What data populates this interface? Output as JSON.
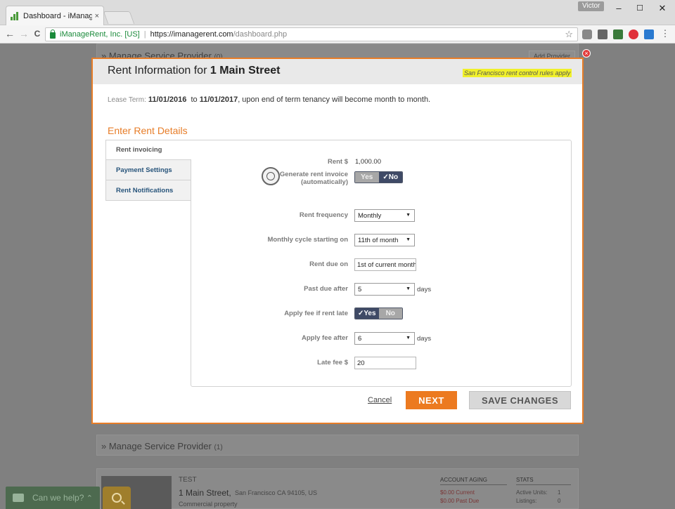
{
  "browser": {
    "tab_title": "Dashboard - iManageRe",
    "tab_close": "×",
    "user_chip": "Victor",
    "min": "–",
    "max": "☐",
    "close": "✕",
    "back": "←",
    "forward": "→",
    "reload": "C",
    "secure_org": "iManageRent, Inc. [US]",
    "url_sep": "|",
    "url_host": "https://imanagerent.com",
    "url_path": "/dashboard.php",
    "star": "☆",
    "menu": "⋮"
  },
  "background": {
    "top_heading": "» Manage Service Provider",
    "top_heading_count": "(0)",
    "add_provider": "Add Provider",
    "mid_heading": "» Manage Service Provider",
    "mid_heading_count": "(1)",
    "listing_tag": "TEST",
    "listing_title": "1 Main Street,",
    "listing_addr": "San Francisco CA 94105, US",
    "listing_type": "Commercial property",
    "aging_header": "ACCOUNT AGING",
    "aging_current": "$0.00 Current",
    "aging_past_due": "$0.00 Past Due",
    "stats_header": "STATS",
    "stats_units_label": "Active Units:",
    "stats_units_value": "1",
    "stats_listings_label": "Listings:",
    "stats_listings_value": "0"
  },
  "chat": {
    "label": "Can we help?",
    "chevron": "⌃"
  },
  "modal": {
    "close": "×",
    "title_prefix": "Rent Information for",
    "title_address": "1 Main Street",
    "rule_badge": "San Francisco rent control rules apply",
    "lease_label": "Lease Term:",
    "lease_start": "11/01/2016",
    "lease_to": "to",
    "lease_end": "11/01/2017",
    "lease_suffix": ", upon end of term tenancy will become month to month.",
    "section_title": "Enter Rent Details",
    "tabs": [
      {
        "label": "Rent invoicing"
      },
      {
        "label": "Payment Settings"
      },
      {
        "label": "Rent Notifications"
      }
    ],
    "form": {
      "rent_label": "Rent $",
      "rent_value": "1,000.00",
      "gen_invoice_label": "Generate rent invoice",
      "gen_invoice_sub": "(automatically)",
      "gen_invoice_yes": "Yes",
      "gen_invoice_no": "✓No",
      "frequency_label": "Rent frequency",
      "frequency_value": "Monthly",
      "cycle_label": "Monthly cycle starting on",
      "cycle_value": "11th of month",
      "due_label": "Rent due on",
      "due_value": "1st of current month",
      "past_due_label": "Past due after",
      "past_due_value": "5",
      "past_due_unit": "days",
      "apply_fee_label": "Apply fee if rent late",
      "apply_fee_yes": "✓Yes",
      "apply_fee_no": "No",
      "fee_after_label": "Apply fee after",
      "fee_after_value": "6",
      "fee_after_unit": "days",
      "late_fee_label": "Late fee $",
      "late_fee_value": "20",
      "caret": "▼"
    },
    "buttons": {
      "cancel": "Cancel",
      "next": "NEXT",
      "save": "SAVE CHANGES"
    }
  }
}
